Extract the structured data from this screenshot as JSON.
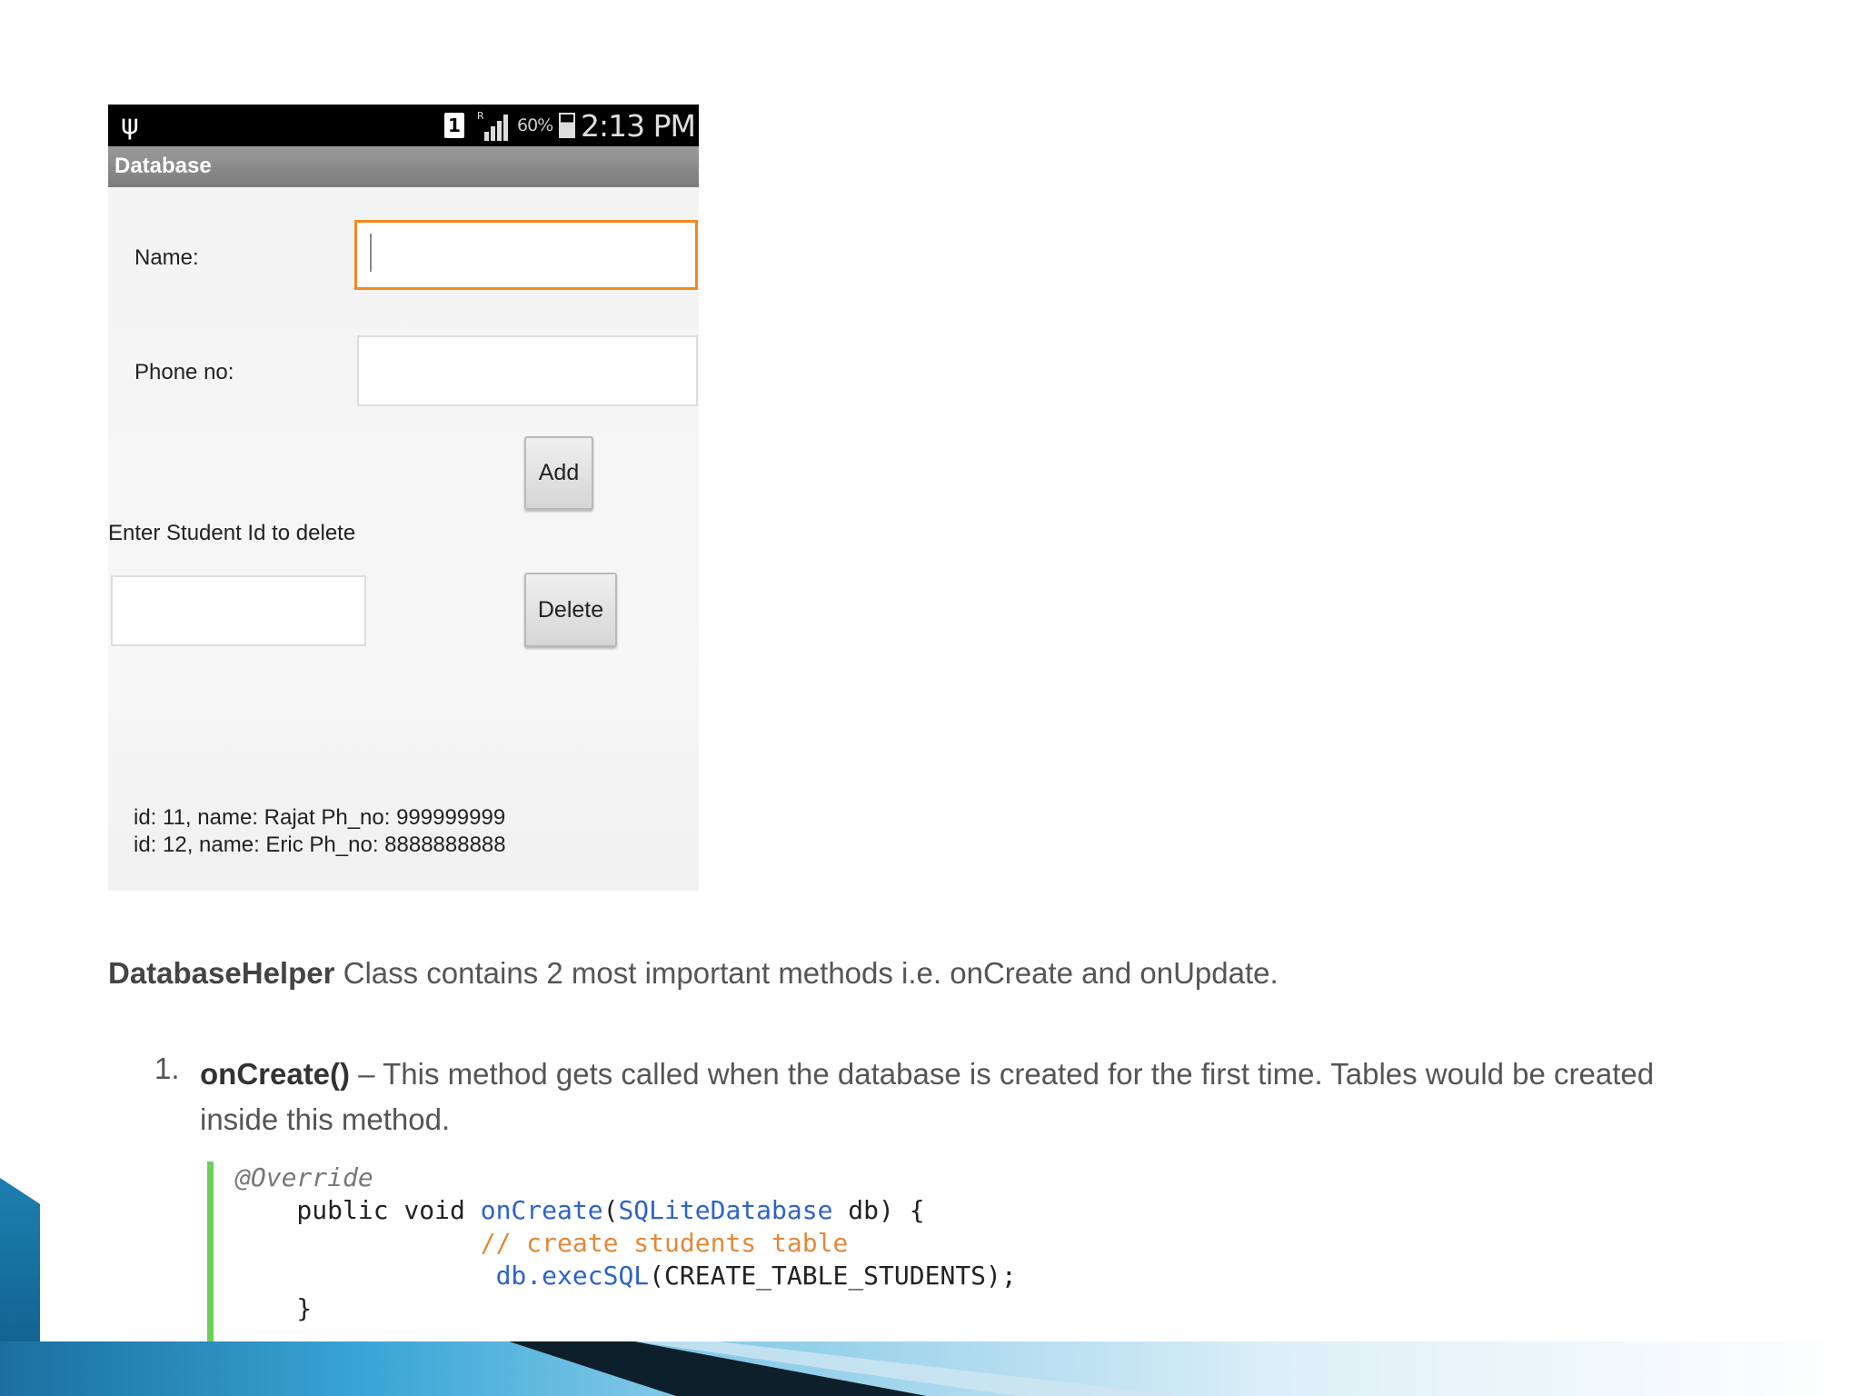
{
  "phone": {
    "status": {
      "battery": "60%",
      "time": "2:13 PM",
      "sim": "1",
      "roaming": "R"
    },
    "app_title": "Database",
    "name_label": "Name:",
    "name_value": "",
    "phone_label": "Phone no:",
    "phone_value": "",
    "add_button": "Add",
    "delete_prompt": "Enter Student Id to delete",
    "delete_id_value": "",
    "delete_button": "Delete",
    "records": [
      "id: 11, name: Rajat Ph_no: 999999999",
      "id: 12, name: Eric Ph_no: 8888888888"
    ]
  },
  "slide": {
    "intro_bold": "DatabaseHelper",
    "intro_rest": " Class contains 2 most important methods i.e. onCreate and onUpdate.",
    "item_number": "1.",
    "item_bold": "onCreate()",
    "item_rest": " – This method gets called when the database is created for the first time. Tables would be created inside this method.",
    "code": {
      "annotation": "@Override",
      "sig_kw": "    public void ",
      "sig_fn": "onCreate",
      "sig_paren": "(",
      "sig_type": "SQLiteDatabase",
      "sig_rest": " db) {",
      "comment": "// create students table",
      "exec_obj": "db.",
      "exec_fn": "execSQL",
      "exec_rest": "(CREATE_TABLE_STUDENTS);",
      "closing": "    }"
    }
  },
  "colors": {
    "focus": "#f08a1c",
    "code_bar": "#6ccf5a",
    "code_fn": "#2e63c9",
    "code_comment": "#e2893a"
  }
}
